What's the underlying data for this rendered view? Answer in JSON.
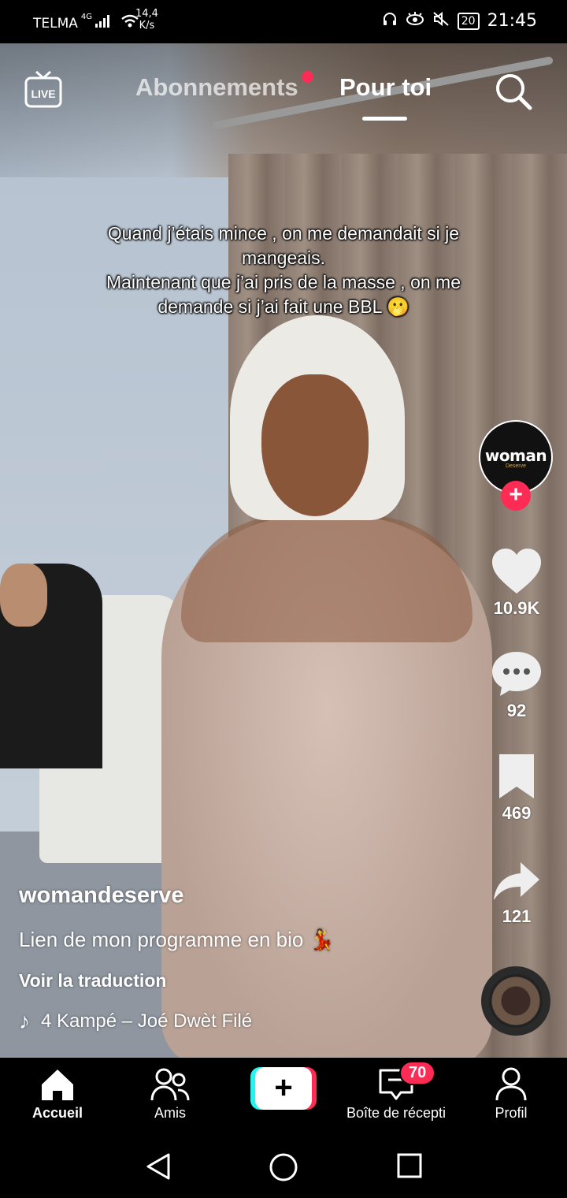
{
  "status_bar": {
    "carrier": "TELMA",
    "network": "4G",
    "speed_value": "14,4",
    "speed_unit": "K/s",
    "battery": "20",
    "battery_level": 0.2,
    "time": "21:45"
  },
  "top_nav": {
    "live_label": "LIVE",
    "tab_following": "Abonnements",
    "tab_for_you": "Pour toi"
  },
  "video": {
    "caption": "Quand j’étais mince , on me demandait si je mangeais.\nMaintenant que j’ai pris de la masse , on me demande si j’ai fait une BBL 🫢"
  },
  "sidebar": {
    "avatar_text": "woman",
    "avatar_sub": "Deserve",
    "likes": "10.9K",
    "comments": "92",
    "saves": "469",
    "shares": "121"
  },
  "post": {
    "username": "womandeserve",
    "description": "Lien de mon programme en bio",
    "description_emoji": "💃",
    "translate": "Voir la traduction",
    "music": "4 Kampé – Joé Dwèt Filé"
  },
  "bottom_nav": {
    "home": "Accueil",
    "friends": "Amis",
    "create": "+",
    "inbox": "Boîte de récepti",
    "inbox_badge": "70",
    "profile": "Profil"
  },
  "colors": {
    "accent": "#fe2c55",
    "cyan": "#25f4ee"
  }
}
